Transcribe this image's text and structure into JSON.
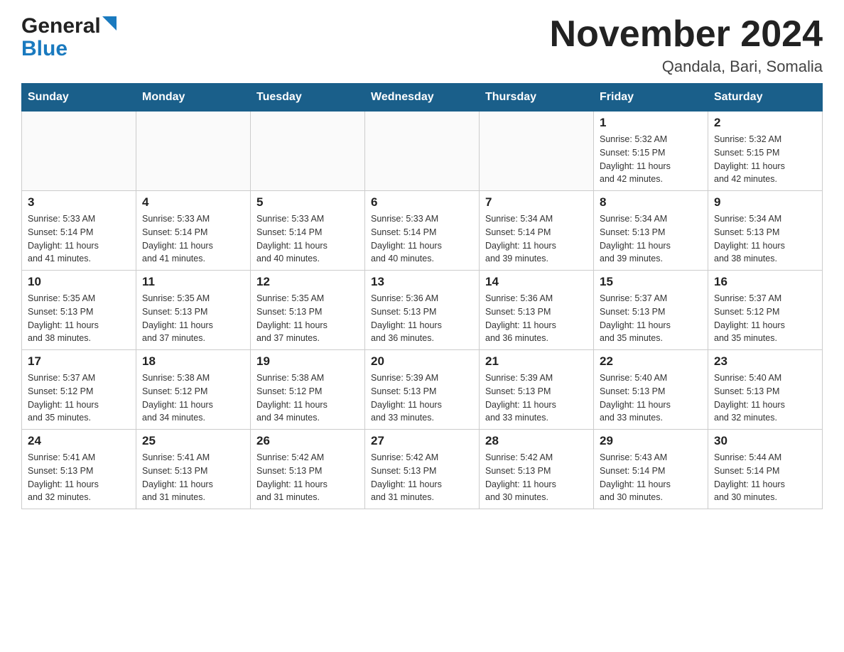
{
  "header": {
    "logo_general": "General",
    "logo_blue": "Blue",
    "title": "November 2024",
    "subtitle": "Qandala, Bari, Somalia"
  },
  "weekdays": [
    "Sunday",
    "Monday",
    "Tuesday",
    "Wednesday",
    "Thursday",
    "Friday",
    "Saturday"
  ],
  "weeks": [
    [
      {
        "day": "",
        "info": ""
      },
      {
        "day": "",
        "info": ""
      },
      {
        "day": "",
        "info": ""
      },
      {
        "day": "",
        "info": ""
      },
      {
        "day": "",
        "info": ""
      },
      {
        "day": "1",
        "info": "Sunrise: 5:32 AM\nSunset: 5:15 PM\nDaylight: 11 hours\nand 42 minutes."
      },
      {
        "day": "2",
        "info": "Sunrise: 5:32 AM\nSunset: 5:15 PM\nDaylight: 11 hours\nand 42 minutes."
      }
    ],
    [
      {
        "day": "3",
        "info": "Sunrise: 5:33 AM\nSunset: 5:14 PM\nDaylight: 11 hours\nand 41 minutes."
      },
      {
        "day": "4",
        "info": "Sunrise: 5:33 AM\nSunset: 5:14 PM\nDaylight: 11 hours\nand 41 minutes."
      },
      {
        "day": "5",
        "info": "Sunrise: 5:33 AM\nSunset: 5:14 PM\nDaylight: 11 hours\nand 40 minutes."
      },
      {
        "day": "6",
        "info": "Sunrise: 5:33 AM\nSunset: 5:14 PM\nDaylight: 11 hours\nand 40 minutes."
      },
      {
        "day": "7",
        "info": "Sunrise: 5:34 AM\nSunset: 5:14 PM\nDaylight: 11 hours\nand 39 minutes."
      },
      {
        "day": "8",
        "info": "Sunrise: 5:34 AM\nSunset: 5:13 PM\nDaylight: 11 hours\nand 39 minutes."
      },
      {
        "day": "9",
        "info": "Sunrise: 5:34 AM\nSunset: 5:13 PM\nDaylight: 11 hours\nand 38 minutes."
      }
    ],
    [
      {
        "day": "10",
        "info": "Sunrise: 5:35 AM\nSunset: 5:13 PM\nDaylight: 11 hours\nand 38 minutes."
      },
      {
        "day": "11",
        "info": "Sunrise: 5:35 AM\nSunset: 5:13 PM\nDaylight: 11 hours\nand 37 minutes."
      },
      {
        "day": "12",
        "info": "Sunrise: 5:35 AM\nSunset: 5:13 PM\nDaylight: 11 hours\nand 37 minutes."
      },
      {
        "day": "13",
        "info": "Sunrise: 5:36 AM\nSunset: 5:13 PM\nDaylight: 11 hours\nand 36 minutes."
      },
      {
        "day": "14",
        "info": "Sunrise: 5:36 AM\nSunset: 5:13 PM\nDaylight: 11 hours\nand 36 minutes."
      },
      {
        "day": "15",
        "info": "Sunrise: 5:37 AM\nSunset: 5:13 PM\nDaylight: 11 hours\nand 35 minutes."
      },
      {
        "day": "16",
        "info": "Sunrise: 5:37 AM\nSunset: 5:12 PM\nDaylight: 11 hours\nand 35 minutes."
      }
    ],
    [
      {
        "day": "17",
        "info": "Sunrise: 5:37 AM\nSunset: 5:12 PM\nDaylight: 11 hours\nand 35 minutes."
      },
      {
        "day": "18",
        "info": "Sunrise: 5:38 AM\nSunset: 5:12 PM\nDaylight: 11 hours\nand 34 minutes."
      },
      {
        "day": "19",
        "info": "Sunrise: 5:38 AM\nSunset: 5:12 PM\nDaylight: 11 hours\nand 34 minutes."
      },
      {
        "day": "20",
        "info": "Sunrise: 5:39 AM\nSunset: 5:13 PM\nDaylight: 11 hours\nand 33 minutes."
      },
      {
        "day": "21",
        "info": "Sunrise: 5:39 AM\nSunset: 5:13 PM\nDaylight: 11 hours\nand 33 minutes."
      },
      {
        "day": "22",
        "info": "Sunrise: 5:40 AM\nSunset: 5:13 PM\nDaylight: 11 hours\nand 33 minutes."
      },
      {
        "day": "23",
        "info": "Sunrise: 5:40 AM\nSunset: 5:13 PM\nDaylight: 11 hours\nand 32 minutes."
      }
    ],
    [
      {
        "day": "24",
        "info": "Sunrise: 5:41 AM\nSunset: 5:13 PM\nDaylight: 11 hours\nand 32 minutes."
      },
      {
        "day": "25",
        "info": "Sunrise: 5:41 AM\nSunset: 5:13 PM\nDaylight: 11 hours\nand 31 minutes."
      },
      {
        "day": "26",
        "info": "Sunrise: 5:42 AM\nSunset: 5:13 PM\nDaylight: 11 hours\nand 31 minutes."
      },
      {
        "day": "27",
        "info": "Sunrise: 5:42 AM\nSunset: 5:13 PM\nDaylight: 11 hours\nand 31 minutes."
      },
      {
        "day": "28",
        "info": "Sunrise: 5:42 AM\nSunset: 5:13 PM\nDaylight: 11 hours\nand 30 minutes."
      },
      {
        "day": "29",
        "info": "Sunrise: 5:43 AM\nSunset: 5:14 PM\nDaylight: 11 hours\nand 30 minutes."
      },
      {
        "day": "30",
        "info": "Sunrise: 5:44 AM\nSunset: 5:14 PM\nDaylight: 11 hours\nand 30 minutes."
      }
    ]
  ]
}
